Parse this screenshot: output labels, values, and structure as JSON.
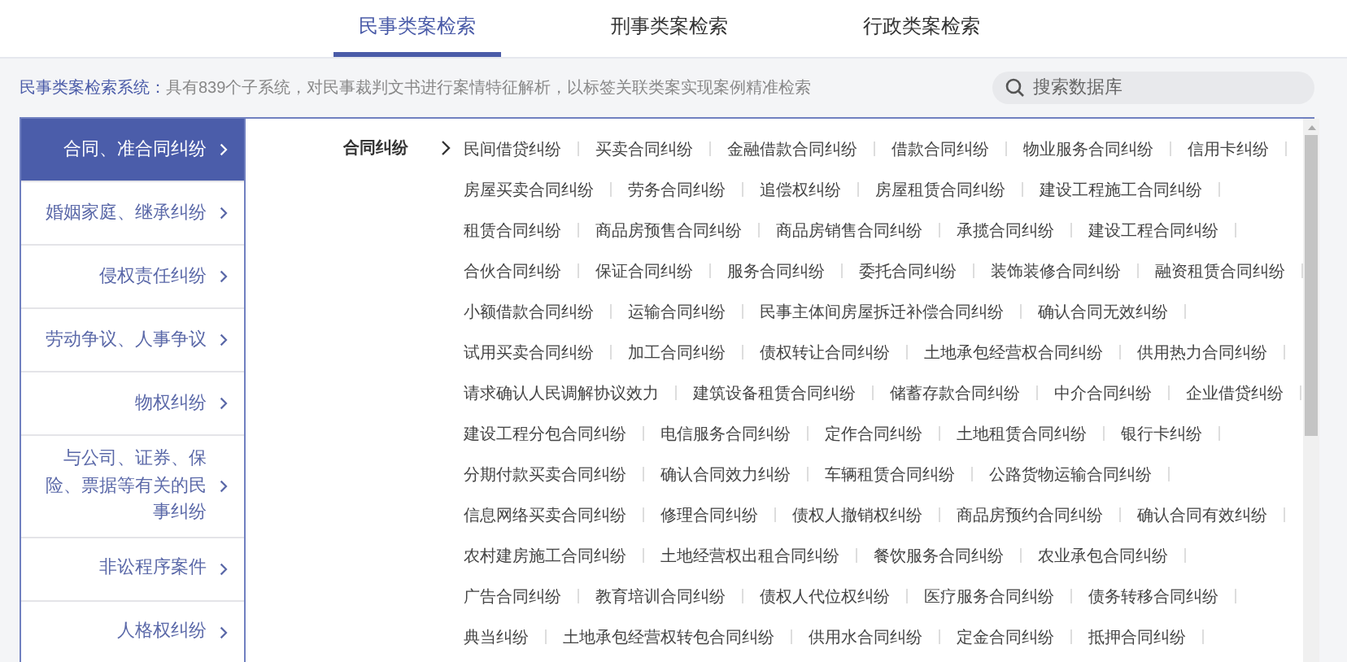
{
  "tabs": [
    {
      "label": "民事类案检索",
      "selected": true
    },
    {
      "label": "刑事类案检索",
      "selected": false
    },
    {
      "label": "行政类案检索",
      "selected": false
    }
  ],
  "intro": {
    "label": "民事类案检索系统：",
    "text": "具有839个子系统，对民事裁判文书进行案情特征解析，以标签关联类案实现案例精准检索"
  },
  "search": {
    "placeholder": "搜索数据库"
  },
  "sidebar": {
    "items": [
      {
        "label": "合同、准合同纠纷",
        "selected": true
      },
      {
        "label": "婚姻家庭、继承纠纷",
        "selected": false
      },
      {
        "label": "侵权责任纠纷",
        "selected": false
      },
      {
        "label": "劳动争议、人事争议",
        "selected": false
      },
      {
        "label": "物权纠纷",
        "selected": false
      },
      {
        "label": "与公司、证券、保险、票据等有关的民事纠纷",
        "selected": false
      },
      {
        "label": "非讼程序案件",
        "selected": false
      },
      {
        "label": "人格权纠纷",
        "selected": false
      }
    ]
  },
  "category": {
    "label": "合同纠纷",
    "rows": [
      [
        "民间借贷纠纷",
        "买卖合同纠纷",
        "金融借款合同纠纷",
        "借款合同纠纷",
        "物业服务合同纠纷",
        "信用卡纠纷"
      ],
      [
        "房屋买卖合同纠纷",
        "劳务合同纠纷",
        "追偿权纠纷",
        "房屋租赁合同纠纷",
        "建设工程施工合同纠纷"
      ],
      [
        "租赁合同纠纷",
        "商品房预售合同纠纷",
        "商品房销售合同纠纷",
        "承揽合同纠纷",
        "建设工程合同纠纷"
      ],
      [
        "合伙合同纠纷",
        "保证合同纠纷",
        "服务合同纠纷",
        "委托合同纠纷",
        "装饰装修合同纠纷",
        "融资租赁合同纠纷"
      ],
      [
        "小额借款合同纠纷",
        "运输合同纠纷",
        "民事主体间房屋拆迁补偿合同纠纷",
        "确认合同无效纠纷"
      ],
      [
        "试用买卖合同纠纷",
        "加工合同纠纷",
        "债权转让合同纠纷",
        "土地承包经营权合同纠纷",
        "供用热力合同纠纷"
      ],
      [
        "请求确认人民调解协议效力",
        "建筑设备租赁合同纠纷",
        "储蓄存款合同纠纷",
        "中介合同纠纷",
        "企业借贷纠纷"
      ],
      [
        "建设工程分包合同纠纷",
        "电信服务合同纠纷",
        "定作合同纠纷",
        "土地租赁合同纠纷",
        "银行卡纠纷"
      ],
      [
        "分期付款买卖合同纠纷",
        "确认合同效力纠纷",
        "车辆租赁合同纠纷",
        "公路货物运输合同纠纷"
      ],
      [
        "信息网络买卖合同纠纷",
        "修理合同纠纷",
        "债权人撤销权纠纷",
        "商品房预约合同纠纷",
        "确认合同有效纠纷"
      ],
      [
        "农村建房施工合同纠纷",
        "土地经营权出租合同纠纷",
        "餐饮服务合同纠纷",
        "农业承包合同纠纷"
      ],
      [
        "广告合同纠纷",
        "教育培训合同纠纷",
        "债权人代位权纠纷",
        "医疗服务合同纠纷",
        "债务转移合同纠纷"
      ],
      [
        "典当纠纷",
        "土地承包经营权转包合同纠纷",
        "供用水合同纠纷",
        "定金合同纠纷",
        "抵押合同纠纷"
      ]
    ]
  }
}
